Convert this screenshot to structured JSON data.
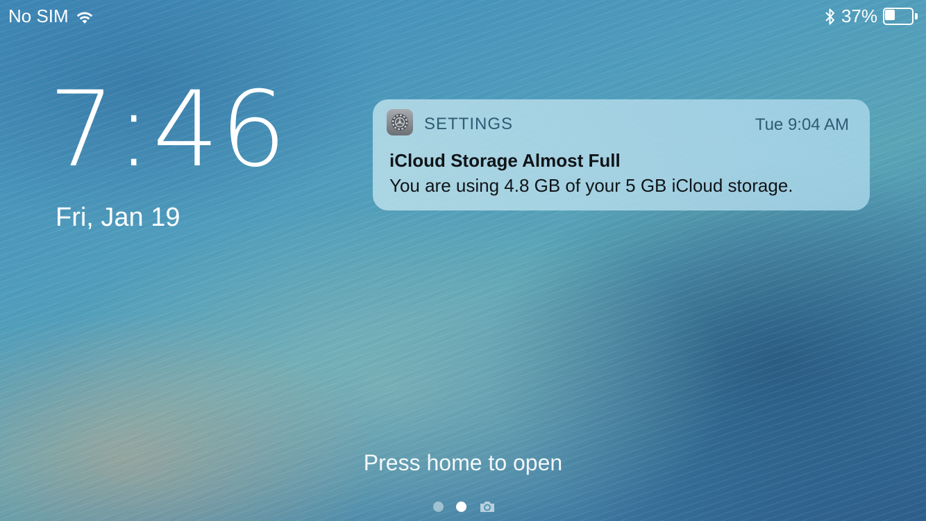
{
  "status_bar": {
    "carrier": "No SIM",
    "battery_percent": "37%",
    "battery_level": 0.37,
    "icons": [
      "wifi-icon",
      "bluetooth-icon",
      "battery-icon"
    ]
  },
  "lock_screen": {
    "time": "7:46",
    "date": "Fri, Jan 19",
    "hint": "Press home to open"
  },
  "notification": {
    "app_icon": "settings-gear-icon",
    "app_name": "SETTINGS",
    "time": "Tue 9:04 AM",
    "title": "iCloud Storage Almost Full",
    "body": "You are using 4.8 GB of your 5 GB iCloud storage."
  },
  "page_indicator": {
    "pages": 2,
    "active_page": 2,
    "camera_icon": "camera-icon"
  }
}
